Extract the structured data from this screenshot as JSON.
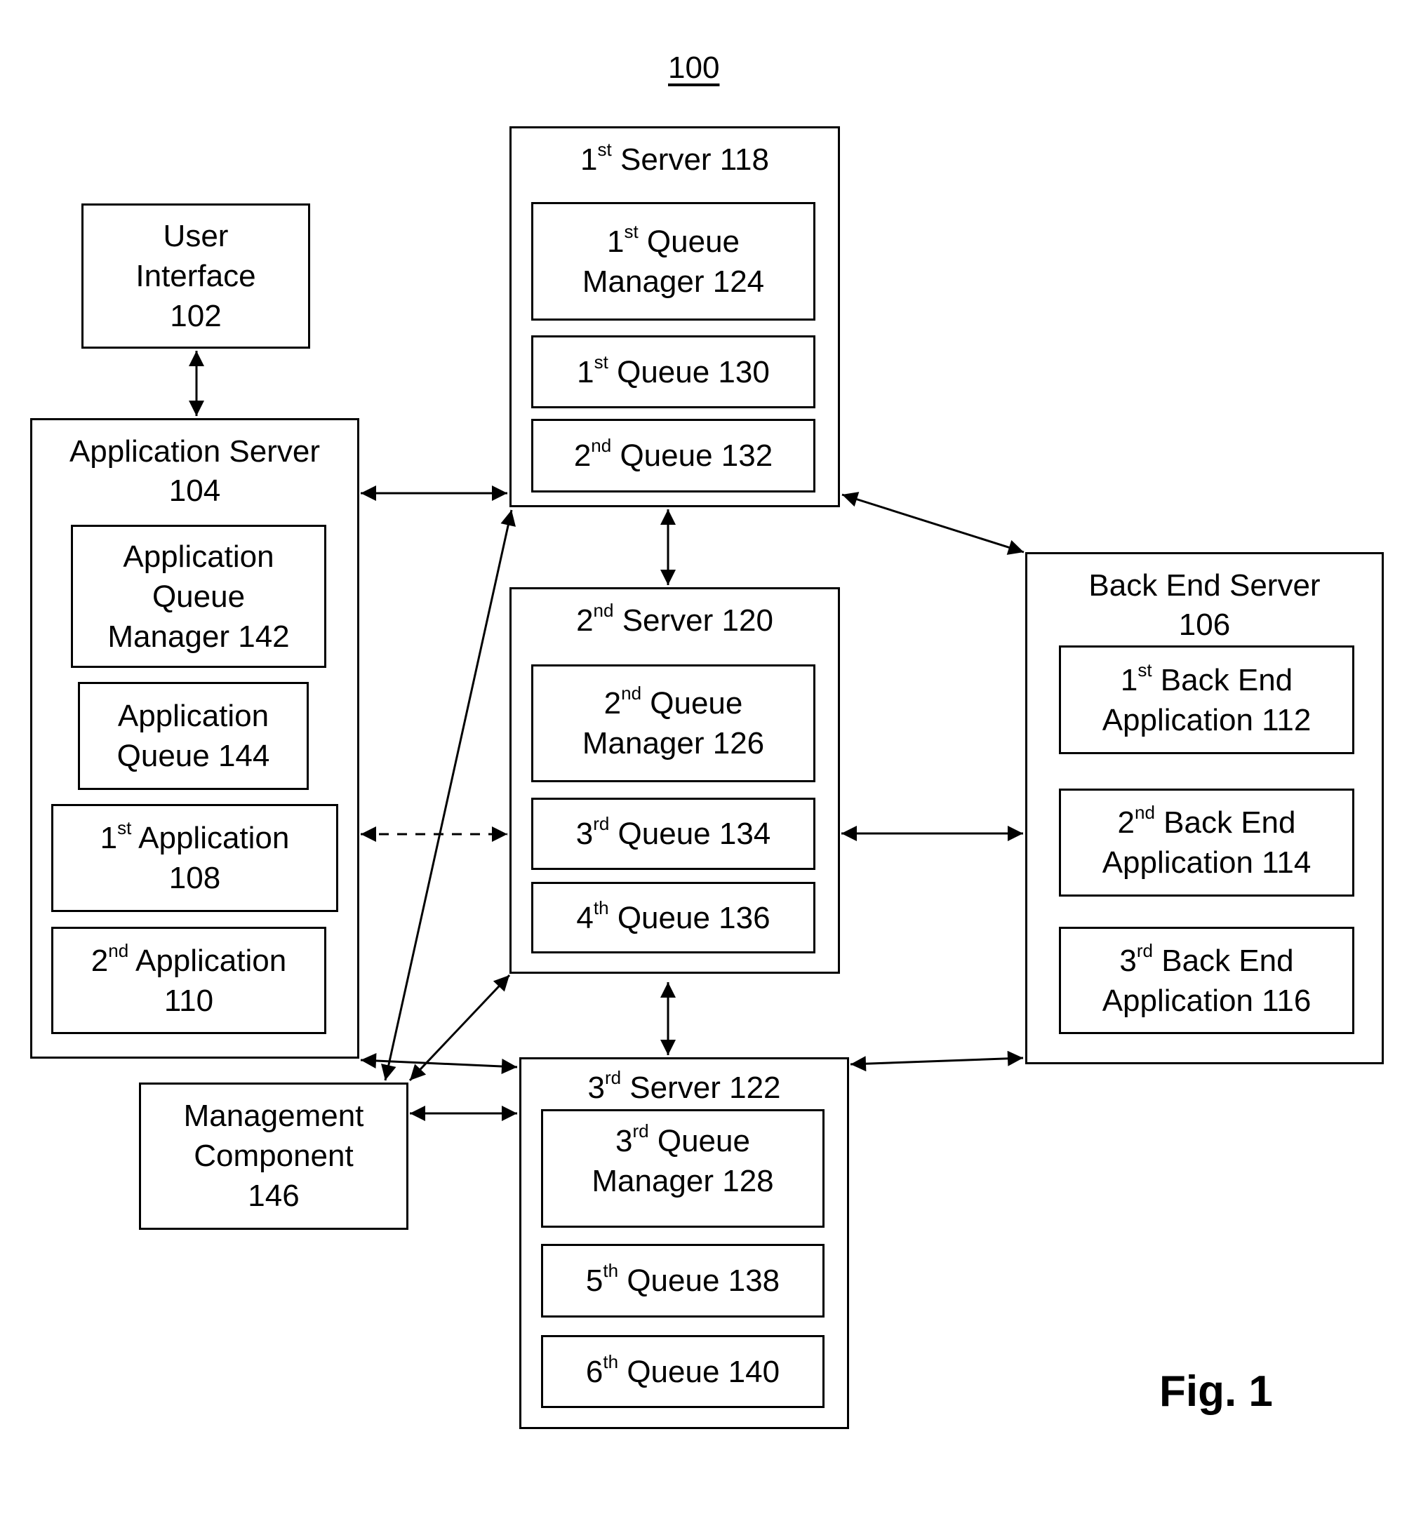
{
  "figure": {
    "reference": "100",
    "caption": "Fig. 1"
  },
  "components": {
    "user_interface": {
      "line1": "User",
      "line2": "Interface",
      "line3": "102"
    },
    "app_server": {
      "title": "Application Server",
      "number": "104",
      "queue_manager": {
        "line1": "Application",
        "line2": "Queue",
        "line3": "Manager 142"
      },
      "queue": {
        "line1": "Application",
        "line2": "Queue 144"
      },
      "app1": {
        "ord": "1",
        "sup": "st",
        "text": " Application",
        "number": "108"
      },
      "app2": {
        "ord": "2",
        "sup": "nd",
        "text": " Application",
        "number": "110"
      }
    },
    "server1": {
      "ord": "1",
      "sup": "st",
      "title": " Server 118",
      "queue_manager": {
        "ord": "1",
        "sup": "st",
        "text": " Queue",
        "line2": "Manager 124"
      },
      "queues": [
        {
          "ord": "1",
          "sup": "st",
          "text": " Queue 130"
        },
        {
          "ord": "2",
          "sup": "nd",
          "text": " Queue 132"
        }
      ]
    },
    "server2": {
      "ord": "2",
      "sup": "nd",
      "title": " Server 120",
      "queue_manager": {
        "ord": "2",
        "sup": "nd",
        "text": " Queue",
        "line2": "Manager 126"
      },
      "queues": [
        {
          "ord": "3",
          "sup": "rd",
          "text": " Queue 134"
        },
        {
          "ord": "4",
          "sup": "th",
          "text": " Queue 136"
        }
      ]
    },
    "server3": {
      "ord": "3",
      "sup": "rd",
      "title": " Server 122",
      "queue_manager": {
        "ord": "3",
        "sup": "rd",
        "text": " Queue",
        "line2": "Manager 128"
      },
      "queues": [
        {
          "ord": "5",
          "sup": "th",
          "text": " Queue 138"
        },
        {
          "ord": "6",
          "sup": "th",
          "text": " Queue 140"
        }
      ]
    },
    "back_end_server": {
      "title": "Back End Server",
      "number": "106",
      "apps": [
        {
          "ord": "1",
          "sup": "st",
          "text": " Back End",
          "line2": "Application 112"
        },
        {
          "ord": "2",
          "sup": "nd",
          "text": " Back End",
          "line2": "Application 114"
        },
        {
          "ord": "3",
          "sup": "rd",
          "text": " Back End",
          "line2": "Application 116"
        }
      ]
    },
    "management": {
      "line1": "Management",
      "line2": "Component",
      "line3": "146"
    }
  },
  "connections": [
    {
      "from": "User Interface 102",
      "to": "Application Server 104",
      "style": "solid",
      "bidirectional": true
    },
    {
      "from": "Application Server 104",
      "to": "1st Server 118",
      "style": "solid",
      "bidirectional": true
    },
    {
      "from": "Application Server 104",
      "to": "2nd Server 120",
      "style": "dashed",
      "bidirectional": true
    },
    {
      "from": "Application Server 104",
      "to": "3rd Server 122",
      "style": "solid",
      "bidirectional": true
    },
    {
      "from": "1st Server 118",
      "to": "2nd Server 120",
      "style": "solid",
      "bidirectional": true
    },
    {
      "from": "2nd Server 120",
      "to": "3rd Server 122",
      "style": "solid",
      "bidirectional": true
    },
    {
      "from": "1st Server 118",
      "to": "Back End Server 106",
      "style": "solid",
      "bidirectional": true
    },
    {
      "from": "2nd Server 120",
      "to": "Back End Server 106",
      "style": "solid",
      "bidirectional": true
    },
    {
      "from": "3rd Server 122",
      "to": "Back End Server 106",
      "style": "solid",
      "bidirectional": true
    },
    {
      "from": "Management Component 146",
      "to": "1st Server 118",
      "style": "solid",
      "bidirectional": true
    },
    {
      "from": "Management Component 146",
      "to": "2nd Server 120",
      "style": "solid",
      "bidirectional": true
    },
    {
      "from": "Management Component 146",
      "to": "3rd Server 122",
      "style": "solid",
      "bidirectional": true
    }
  ]
}
